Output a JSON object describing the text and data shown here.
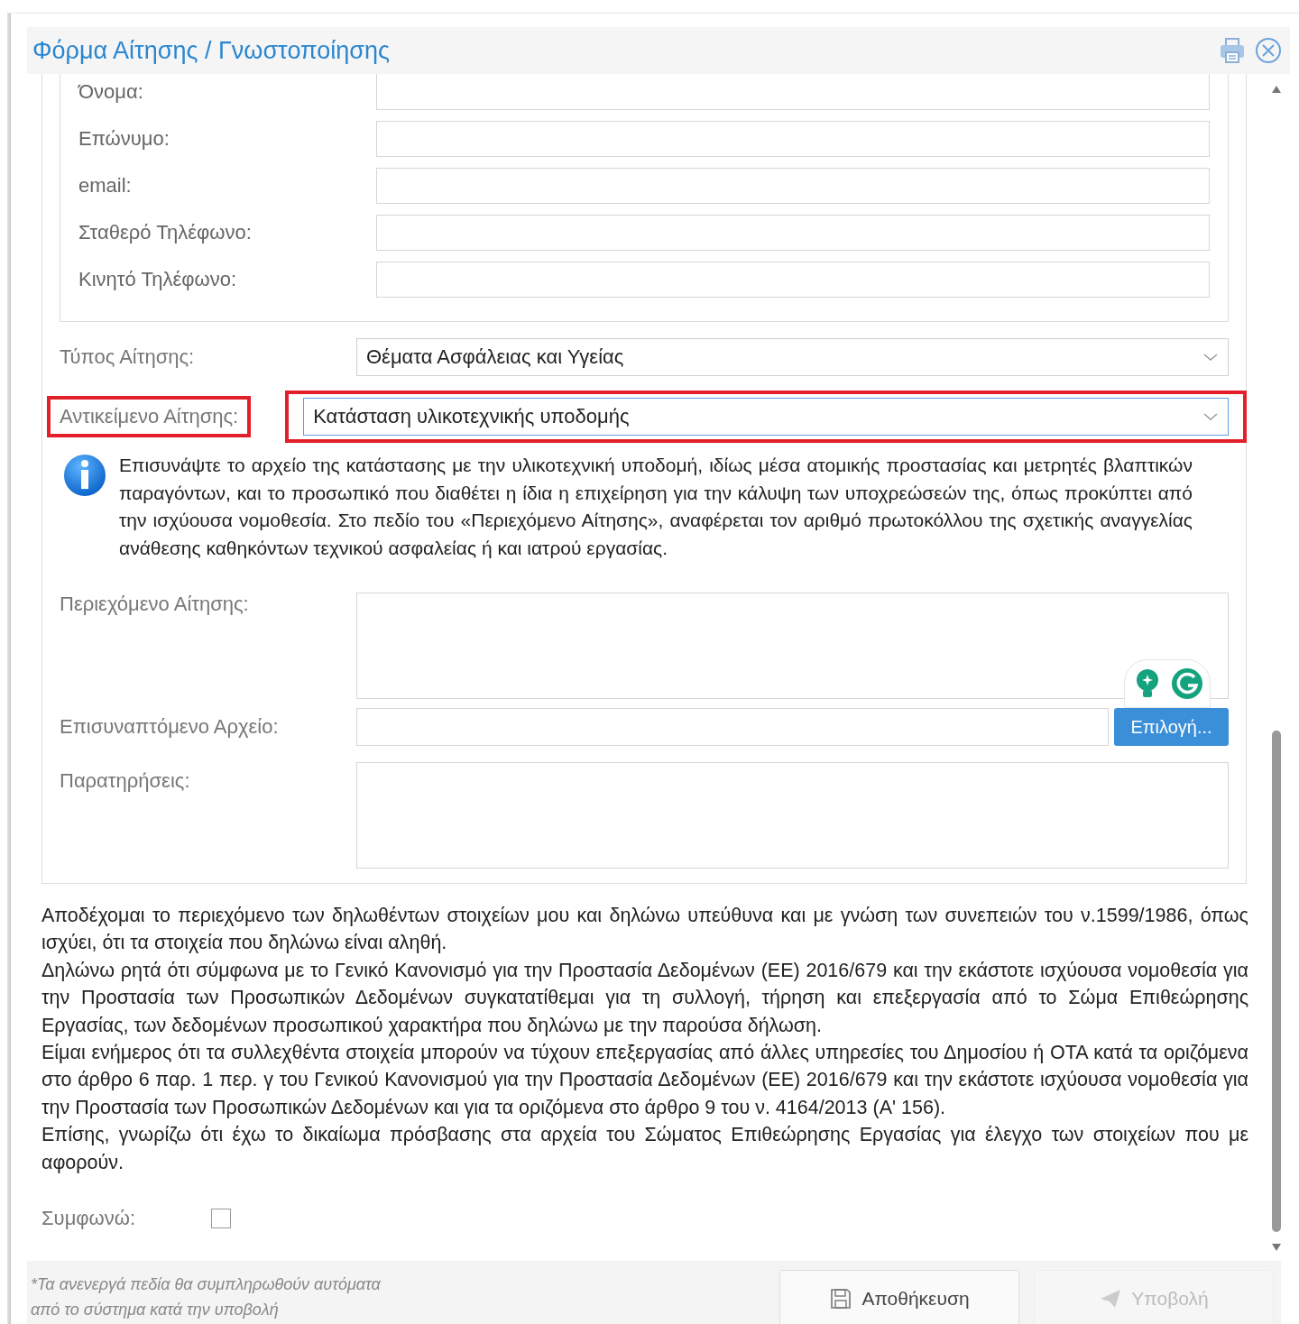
{
  "window": {
    "title": "Φόρμα Αίτησης / Γνωστοποίησης"
  },
  "contact_fields": [
    {
      "label": "Όνομα:"
    },
    {
      "label": "Επώνυμο:"
    },
    {
      "label": "email:"
    },
    {
      "label": "Σταθερό Τηλέφωνο:"
    },
    {
      "label": "Κινητό Τηλέφωνο:"
    }
  ],
  "request_type": {
    "label": "Τύπος Αίτησης:",
    "value": "Θέματα Ασφάλειας και Υγείας",
    "highlighted": false
  },
  "request_subject": {
    "label": "Αντικείμενο Αίτησης:",
    "value": "Κατάσταση υλικοτεχνικής υποδομής",
    "highlighted": true
  },
  "info_note": "Επισυνάψτε το αρχείο της κατάστασης με την υλικοτεχνική υποδομή, ιδίως μέσα ατομικής προστασίας και μετρητές βλαπτικών παραγόντων, και το προσωπικό που διαθέτει η ίδια η επιχείρηση για την κάλυψη των υποχρεώσεών της, όπως προκύπτει από την ισχύουσα νομοθεσία. Στο πεδίο του «Περιεχόμενο Αίτησης», αναφέρεται τον αριθμό πρωτοκόλλου της σχετικής αναγγελίας ανάθεσης καθηκόντων τεχνικού ασφαλείας ή και ιατρού εργασίας.",
  "content_field": {
    "label": "Περιεχόμενο Αίτησης:"
  },
  "attachment": {
    "label": "Επισυναπτόμενο Αρχείο:",
    "button": "Επιλογή..."
  },
  "remarks": {
    "label": "Παρατηρήσεις:"
  },
  "declaration": [
    "Αποδέχομαι το περιεχόμενο των δηλωθέντων στοιχείων μου και δηλώνω υπεύθυνα και με γνώση των συνεπειών του ν.1599/1986, όπως ισχύει, ότι τα στοιχεία που δηλώνω είναι αληθή.",
    "Δηλώνω ρητά ότι σύμφωνα με το Γενικό Κανονισμό για την Προστασία Δεδομένων (ΕΕ) 2016/679 και την εκάστοτε ισχύουσα νομοθεσία για την Προστασία των Προσωπικών Δεδομένων συγκατατίθεμαι για τη συλλογή, τήρηση και επεξεργασία από το Σώμα Επιθεώρησης Εργασίας, των δεδομένων προσωπικού χαρακτήρα που δηλώνω με την παρούσα δήλωση.",
    "Είμαι ενήμερος ότι τα συλλεχθέντα στοιχεία μπορούν να τύχουν επεξεργασίας από άλλες υπηρεσίες του Δημοσίου ή ΟΤΑ κατά τα οριζόμενα στο άρθρο 6 παρ. 1 περ. γ του Γενικού Κανονισμού για την Προστασία Δεδομένων (ΕΕ) 2016/679 και την εκάστοτε ισχύουσα νομοθεσία για την Προστασία των Προσωπικών Δεδομένων και για τα οριζόμενα στο άρθρο 9 του ν. 4164/2013 (Α' 156).",
    "Επίσης, γνωρίζω ότι έχω το δικαίωμα πρόσβασης στα αρχεία του Σώματος Επιθεώρησης Εργασίας για έλεγχο των στοιχείων που με αφορούν."
  ],
  "agree": {
    "label": "Συμφωνώ:",
    "checked": false
  },
  "footnote": [
    "*Τα ανενεργά πεδία θα συμπληρωθούν αυτόματα",
    "από το σύστημα κατά την υποβολή"
  ],
  "buttons": [
    {
      "label": "Αποθήκευση",
      "kind": "save",
      "disabled": false
    },
    {
      "label": "Υποβολή",
      "kind": "submit",
      "disabled": true
    }
  ]
}
